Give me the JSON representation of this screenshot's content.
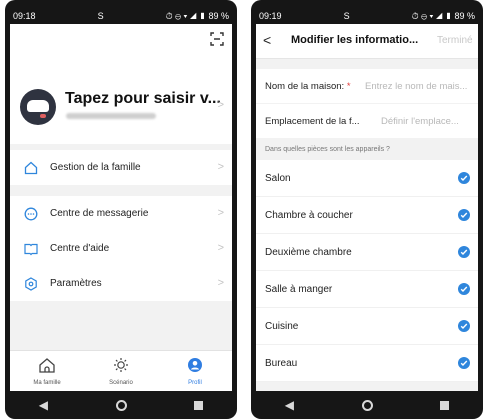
{
  "left": {
    "status": {
      "time": "09:18",
      "app_glyph": "S",
      "icons": "⏱ ⊖ ▾ ◢ ▮ 89 %"
    },
    "profile": {
      "name": "Tapez pour saisir v...",
      "email": " "
    },
    "menu_group_1": [
      {
        "label": "Gestion de la famille",
        "icon": "home-outline-icon"
      }
    ],
    "menu_group_2": [
      {
        "label": "Centre de messagerie",
        "icon": "message-icon"
      },
      {
        "label": "Centre d'aide",
        "icon": "book-icon"
      },
      {
        "label": "Paramètres",
        "icon": "settings-icon"
      }
    ],
    "tabs": [
      {
        "label": "Ma famille",
        "icon": "home-icon"
      },
      {
        "label": "Scénario",
        "icon": "sun-icon"
      },
      {
        "label": "Profil",
        "icon": "profile-icon",
        "active": true
      }
    ]
  },
  "right": {
    "status": {
      "time": "09:19",
      "app_glyph": "S",
      "icons": "⏱ ⊖ ▾ ◢ ▮ 89 %"
    },
    "header": {
      "back": "<",
      "title": "Modifier les informatio...",
      "done": "Terminé"
    },
    "fields": [
      {
        "label": "Nom de la maison:",
        "required": "*",
        "placeholder": "Entrez le nom de mais..."
      },
      {
        "label": "Emplacement de la f...",
        "placeholder": "Définir l'emplace..."
      }
    ],
    "section_label": "Dans quelles pièces sont les appareils ?",
    "rooms": [
      {
        "name": "Salon",
        "checked": true
      },
      {
        "name": "Chambre à coucher",
        "checked": true
      },
      {
        "name": "Deuxième chambre",
        "checked": true
      },
      {
        "name": "Salle à manger",
        "checked": true
      },
      {
        "name": "Cuisine",
        "checked": true
      },
      {
        "name": "Bureau",
        "checked": true
      }
    ]
  },
  "colors": {
    "accent": "#2f86dc",
    "required": "#e23b3b",
    "placeholder": "#b8b8b8"
  }
}
